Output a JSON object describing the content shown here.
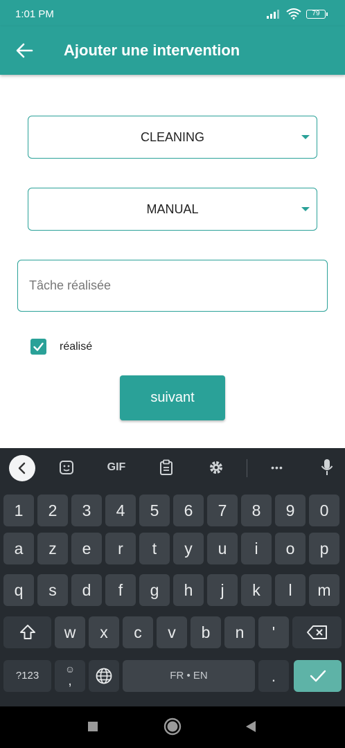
{
  "status_bar": {
    "time": "1:01 PM",
    "battery": "79"
  },
  "app_bar": {
    "title": "Ajouter une intervention"
  },
  "form": {
    "type_value": "CLEANING",
    "mode_value": "MANUAL",
    "task_placeholder": "Tâche réalisée",
    "done_label": "réalisé",
    "done_checked": true,
    "next_label": "suivant"
  },
  "keyboard": {
    "tools": [
      "collapse-icon",
      "sticker-icon",
      "gif",
      "clipboard-icon",
      "gear-icon",
      "more-icon",
      "mic-icon"
    ],
    "gif_label": "GIF",
    "more_label": "•••",
    "row_numbers": [
      "1",
      "2",
      "3",
      "4",
      "5",
      "6",
      "7",
      "8",
      "9",
      "0"
    ],
    "row1": [
      "a",
      "z",
      "e",
      "r",
      "t",
      "y",
      "u",
      "i",
      "o",
      "p"
    ],
    "row2": [
      "q",
      "s",
      "d",
      "f",
      "g",
      "h",
      "j",
      "k",
      "l",
      "m"
    ],
    "row3": [
      "w",
      "x",
      "c",
      "v",
      "b",
      "n",
      "'"
    ],
    "symbols_label": "?123",
    "emoji_top": "☺",
    "emoji_bottom": ",",
    "space_label": "FR • EN",
    "period_label": "."
  },
  "colors": {
    "accent": "#2aa198",
    "keyboard_bg": "#262b30",
    "key_bg": "#3e444a",
    "enter_bg": "#5eb3a7"
  }
}
